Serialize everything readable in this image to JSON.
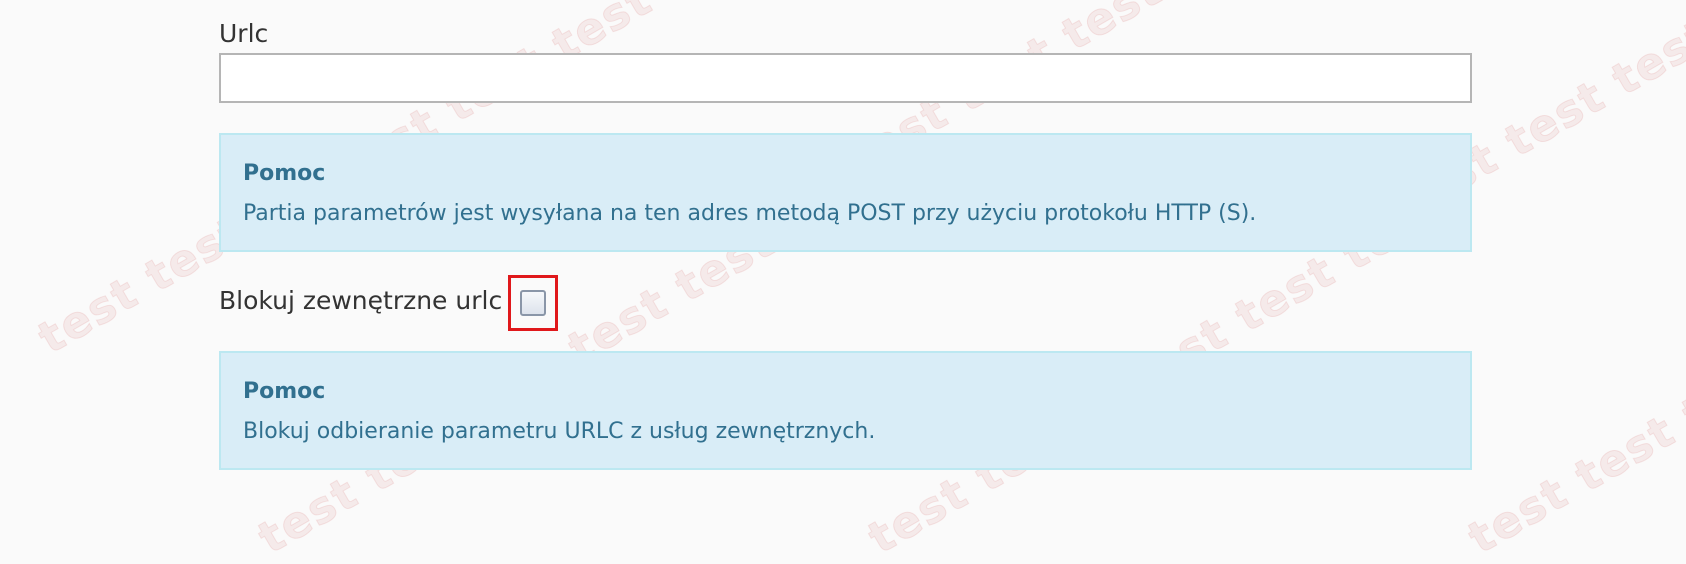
{
  "urlc_field": {
    "label": "Urlc",
    "value": "",
    "placeholder": ""
  },
  "help_1": {
    "title": "Pomoc",
    "text": "Partia parametrów jest wysyłana na ten adres metodą POST przy użyciu protokołu HTTP (S)."
  },
  "block_external_urlc": {
    "label": "Blokuj zewnętrzne urlc",
    "checked": false
  },
  "help_2": {
    "title": "Pomoc",
    "text": "Blokuj odbieranie parametru URLC z usług zewnętrznych."
  },
  "watermark": {
    "text": "test test test"
  },
  "colors": {
    "help_background": "#d9edf7",
    "help_border": "#bce8f1",
    "help_text": "#31708f",
    "highlight_border": "#e0181b"
  }
}
